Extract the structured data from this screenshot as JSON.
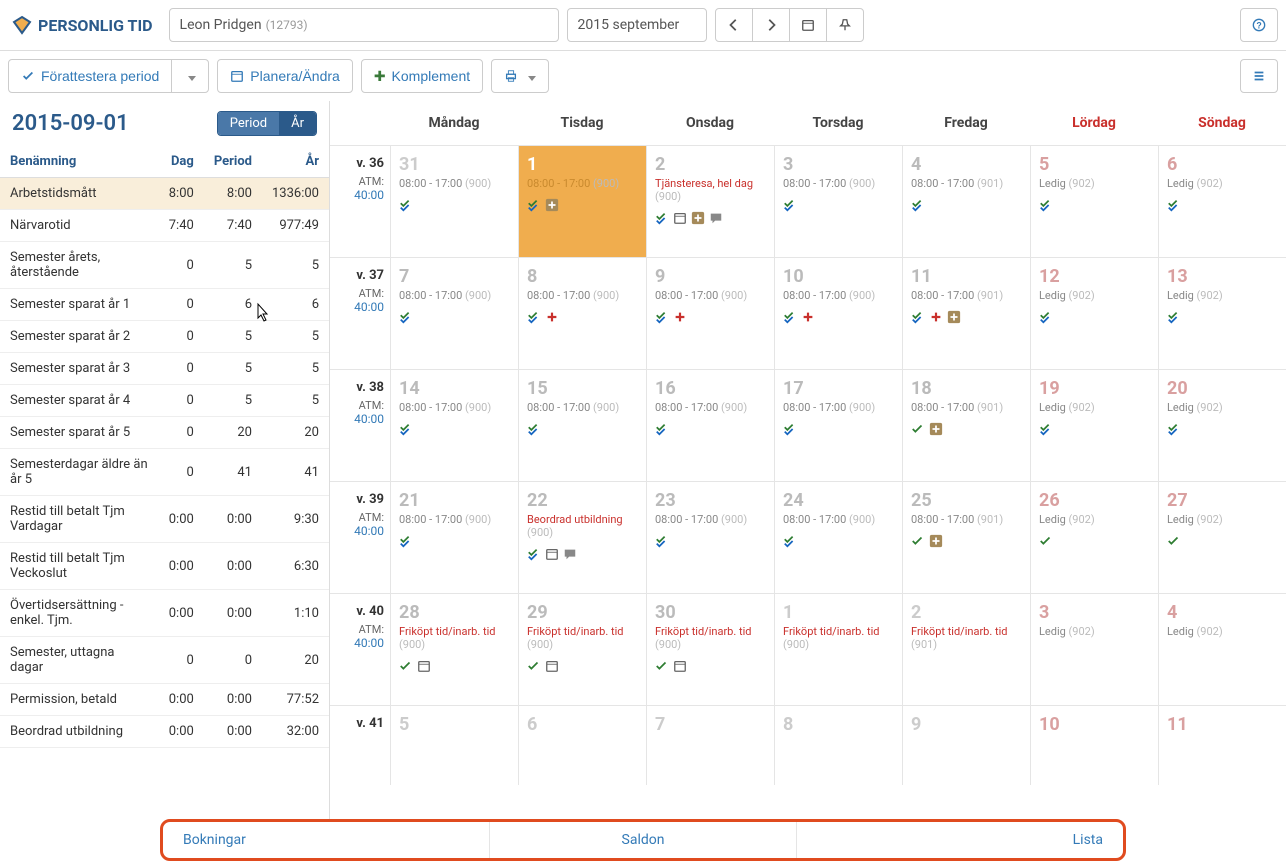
{
  "app": {
    "title": "PERSONLIG TID"
  },
  "top": {
    "person_name": "Leon Pridgen",
    "person_id": "(12793)",
    "month": "2015 september"
  },
  "toolbar": {
    "attest": "Förattestera period",
    "plan": "Planera/Ändra",
    "complement": "Komplement"
  },
  "left": {
    "date": "2015-09-01",
    "toggle_period": "Period",
    "toggle_year": "År",
    "headers": {
      "name": "Benämning",
      "day": "Dag",
      "period": "Period",
      "year": "År"
    },
    "rows": [
      {
        "name": "Arbetstidsmått",
        "day": "8:00",
        "period": "8:00",
        "year": "1336:00",
        "hl": true
      },
      {
        "name": "Närvarotid",
        "day": "7:40",
        "period": "7:40",
        "year": "977:49"
      },
      {
        "name": "Semester årets, återstående",
        "day": "0",
        "period": "5",
        "year": "5"
      },
      {
        "name": "Semester sparat år 1",
        "day": "0",
        "period": "6",
        "year": "6"
      },
      {
        "name": "Semester sparat år 2",
        "day": "0",
        "period": "5",
        "year": "5"
      },
      {
        "name": "Semester sparat år 3",
        "day": "0",
        "period": "5",
        "year": "5"
      },
      {
        "name": "Semester sparat år 4",
        "day": "0",
        "period": "5",
        "year": "5"
      },
      {
        "name": "Semester sparat år 5",
        "day": "0",
        "period": "20",
        "year": "20"
      },
      {
        "name": "Semesterdagar äldre än år 5",
        "day": "0",
        "period": "41",
        "year": "41"
      },
      {
        "name": "Restid till betalt Tjm Vardagar",
        "day": "0:00",
        "period": "0:00",
        "year": "9:30"
      },
      {
        "name": "Restid till betalt Tjm Veckoslut",
        "day": "0:00",
        "period": "0:00",
        "year": "6:30"
      },
      {
        "name": "Övertidsersättning - enkel. Tjm.",
        "day": "0:00",
        "period": "0:00",
        "year": "1:10"
      },
      {
        "name": "Semester, uttagna dagar",
        "day": "0",
        "period": "0",
        "year": "20"
      },
      {
        "name": "Permission, betald",
        "day": "0:00",
        "period": "0:00",
        "year": "77:52"
      },
      {
        "name": "Beordrad utbildning",
        "day": "0:00",
        "period": "0:00",
        "year": "32:00"
      }
    ]
  },
  "calendar": {
    "days": [
      "Måndag",
      "Tisdag",
      "Onsdag",
      "Torsdag",
      "Fredag",
      "Lördag",
      "Söndag"
    ],
    "atm_label": "ATM:",
    "weeks": [
      {
        "wk": "v. 36",
        "atm": "40:00",
        "cells": [
          {
            "n": "31",
            "txt": "08:00 - 17:00",
            "code": "(900)",
            "icons": [
              "dblcheck"
            ],
            "other": true
          },
          {
            "n": "1",
            "txt": "08:00 - 17:00",
            "code": "(900)",
            "icons": [
              "dblcheck",
              "plusbox"
            ],
            "selected": true
          },
          {
            "n": "2",
            "txt": "Tjänsteresa, hel dag",
            "code": "(900)",
            "red": true,
            "icons": [
              "dblcheck",
              "cal",
              "plusbox",
              "chat"
            ]
          },
          {
            "n": "3",
            "txt": "08:00 - 17:00",
            "code": "(900)",
            "icons": [
              "dblcheck"
            ]
          },
          {
            "n": "4",
            "txt": "08:00 - 17:00",
            "code": "(901)",
            "icons": [
              "dblcheck"
            ]
          },
          {
            "n": "5",
            "txt": "Ledig",
            "code": "(902)",
            "icons": [
              "dblcheck"
            ],
            "weekend": true
          },
          {
            "n": "6",
            "txt": "Ledig",
            "code": "(902)",
            "icons": [
              "dblcheck"
            ],
            "weekend": true
          }
        ]
      },
      {
        "wk": "v. 37",
        "atm": "40:00",
        "cells": [
          {
            "n": "7",
            "txt": "08:00 - 17:00",
            "code": "(900)",
            "icons": [
              "dblcheck"
            ]
          },
          {
            "n": "8",
            "txt": "08:00 - 17:00",
            "code": "(900)",
            "icons": [
              "dblcheck",
              "plusred"
            ]
          },
          {
            "n": "9",
            "txt": "08:00 - 17:00",
            "code": "(900)",
            "icons": [
              "dblcheck",
              "plusred"
            ]
          },
          {
            "n": "10",
            "txt": "08:00 - 17:00",
            "code": "(900)",
            "icons": [
              "dblcheck",
              "plusred"
            ]
          },
          {
            "n": "11",
            "txt": "08:00 - 17:00",
            "code": "(901)",
            "icons": [
              "dblcheck",
              "plusred",
              "plusbox"
            ]
          },
          {
            "n": "12",
            "txt": "Ledig",
            "code": "(902)",
            "icons": [
              "dblcheck"
            ],
            "weekend": true
          },
          {
            "n": "13",
            "txt": "Ledig",
            "code": "(902)",
            "icons": [
              "dblcheck"
            ],
            "weekend": true
          }
        ]
      },
      {
        "wk": "v. 38",
        "atm": "40:00",
        "cells": [
          {
            "n": "14",
            "txt": "08:00 - 17:00",
            "code": "(900)",
            "icons": [
              "dblcheck"
            ]
          },
          {
            "n": "15",
            "txt": "08:00 - 17:00",
            "code": "(900)",
            "icons": [
              "dblcheck"
            ]
          },
          {
            "n": "16",
            "txt": "08:00 - 17:00",
            "code": "(900)",
            "icons": [
              "dblcheck"
            ]
          },
          {
            "n": "17",
            "txt": "08:00 - 17:00",
            "code": "(900)",
            "icons": [
              "dblcheck"
            ]
          },
          {
            "n": "18",
            "txt": "08:00 - 17:00",
            "code": "(901)",
            "icons": [
              "check",
              "plusbox"
            ]
          },
          {
            "n": "19",
            "txt": "Ledig",
            "code": "(902)",
            "icons": [
              "dblcheck"
            ],
            "weekend": true
          },
          {
            "n": "20",
            "txt": "Ledig",
            "code": "(902)",
            "icons": [
              "dblcheck"
            ],
            "weekend": true
          }
        ]
      },
      {
        "wk": "v. 39",
        "atm": "40:00",
        "cells": [
          {
            "n": "21",
            "txt": "08:00 - 17:00",
            "code": "(900)",
            "icons": [
              "dblcheck"
            ]
          },
          {
            "n": "22",
            "txt": "Beordrad utbildning",
            "code": "(900)",
            "red": true,
            "icons": [
              "dblcheck",
              "cal",
              "chat"
            ]
          },
          {
            "n": "23",
            "txt": "08:00 - 17:00",
            "code": "(900)",
            "icons": [
              "dblcheck"
            ]
          },
          {
            "n": "24",
            "txt": "08:00 - 17:00",
            "code": "(900)",
            "icons": [
              "dblcheck"
            ]
          },
          {
            "n": "25",
            "txt": "08:00 - 17:00",
            "code": "(901)",
            "icons": [
              "check",
              "plusbox"
            ]
          },
          {
            "n": "26",
            "txt": "Ledig",
            "code": "(902)",
            "icons": [
              "check"
            ],
            "weekend": true
          },
          {
            "n": "27",
            "txt": "Ledig",
            "code": "(902)",
            "icons": [
              "check"
            ],
            "weekend": true
          }
        ]
      },
      {
        "wk": "v. 40",
        "atm": "40:00",
        "cells": [
          {
            "n": "28",
            "txt": "Friköpt tid/inarb. tid",
            "code": "(900)",
            "red": true,
            "icons": [
              "check",
              "cal"
            ]
          },
          {
            "n": "29",
            "txt": "Friköpt tid/inarb. tid",
            "code": "(900)",
            "red": true,
            "icons": [
              "check",
              "cal"
            ]
          },
          {
            "n": "30",
            "txt": "Friköpt tid/inarb. tid",
            "code": "(900)",
            "red": true,
            "icons": [
              "check",
              "cal"
            ]
          },
          {
            "n": "1",
            "txt": "Friköpt tid/inarb. tid",
            "code": "(900)",
            "red": true,
            "icons": [],
            "other": true
          },
          {
            "n": "2",
            "txt": "Friköpt tid/inarb. tid",
            "code": "(901)",
            "red": true,
            "icons": [],
            "other": true
          },
          {
            "n": "3",
            "txt": "Ledig",
            "code": "(902)",
            "icons": [],
            "weekend": true,
            "other": true
          },
          {
            "n": "4",
            "txt": "Ledig",
            "code": "(902)",
            "icons": [],
            "weekend": true,
            "other": true
          }
        ]
      },
      {
        "wk": "v. 41",
        "atm": "",
        "short": true,
        "cells": [
          {
            "n": "5",
            "other": true
          },
          {
            "n": "6",
            "other": true
          },
          {
            "n": "7",
            "other": true
          },
          {
            "n": "8",
            "other": true
          },
          {
            "n": "9",
            "other": true
          },
          {
            "n": "10",
            "other": true,
            "weekend": true
          },
          {
            "n": "11",
            "other": true,
            "weekend": true
          }
        ]
      }
    ]
  },
  "bottom": {
    "tabs": [
      "Bokningar",
      "Saldon",
      "Lista"
    ]
  }
}
